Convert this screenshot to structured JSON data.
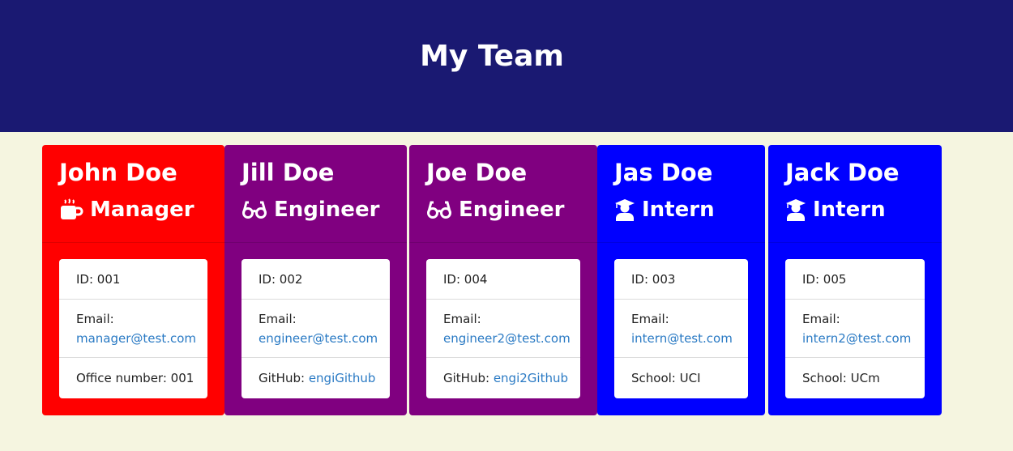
{
  "page": {
    "title": "My Team"
  },
  "colors": {
    "header": "#1a1972",
    "background": "#f5f5e0",
    "manager": "#ff0000",
    "engineer": "#800080",
    "intern": "#0000ff",
    "link": "#2a7ac4"
  },
  "employees": [
    {
      "name": "John Doe",
      "role": "Manager",
      "role_icon": "coffee-mug-icon",
      "id_text": "ID: 001",
      "email_label": "Email:",
      "email": "manager@test.com",
      "extra_label": "Office number: 001",
      "extra_link": ""
    },
    {
      "name": "Jill Doe",
      "role": "Engineer",
      "role_icon": "glasses-icon",
      "id_text": "ID: 002",
      "email_label": "Email:",
      "email": "engineer@test.com",
      "extra_label": "GitHub: ",
      "extra_link": "engiGithub"
    },
    {
      "name": "Joe Doe",
      "role": "Engineer",
      "role_icon": "glasses-icon",
      "id_text": "ID: 004",
      "email_label": "Email:",
      "email": "engineer2@test.com",
      "extra_label": "GitHub: ",
      "extra_link": "engi2Github"
    },
    {
      "name": "Jas Doe",
      "role": "Intern",
      "role_icon": "graduate-icon",
      "id_text": "ID: 003",
      "email_label": "Email:",
      "email": "intern@test.com",
      "extra_label": "School: UCI",
      "extra_link": ""
    },
    {
      "name": "Jack Doe",
      "role": "Intern",
      "role_icon": "graduate-icon",
      "id_text": "ID: 005",
      "email_label": "Email:",
      "email": "intern2@test.com",
      "extra_label": "School: UCm",
      "extra_link": ""
    }
  ]
}
